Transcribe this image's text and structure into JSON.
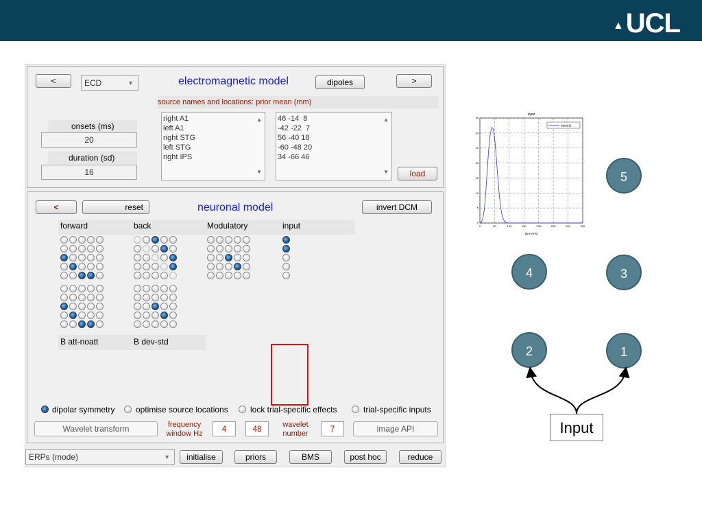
{
  "header": {
    "logo_text": "UCL"
  },
  "em_panel": {
    "prev_label": "<",
    "next_label": ">",
    "model_select": "ECD",
    "title": "electromagnetic model",
    "dipoles_label": "dipoles",
    "sources_caption": "source names and locations: prior mean (mm)",
    "onsets_label": "onsets (ms)",
    "onsets_value": "20",
    "duration_label": "duration (sd)",
    "duration_value": "16",
    "source_names": [
      "right A1",
      "left A1",
      "right STG",
      "left STG",
      "right IPS"
    ],
    "source_locations": [
      "46 -14  8",
      "-42 -22  7",
      "56 -40 18",
      "-60 -48 20",
      "34 -66 46"
    ],
    "load_label": "load"
  },
  "nm_panel": {
    "back_label": "<",
    "reset_label": "reset",
    "title": "neuronal model",
    "invert_label": "invert DCM",
    "col_headers": [
      "forward",
      "back",
      "Modulatory",
      "input"
    ],
    "b_labels": [
      "B att-noatt",
      "B dev-std"
    ],
    "options": [
      "dipolar symmetry",
      "optimise source locations",
      "lock trial-specific effects",
      "trial-specific inputs"
    ],
    "options_checked": [
      true,
      false,
      false,
      false
    ],
    "wavelet_label": "Wavelet transform",
    "freq_label": "frequency window Hz",
    "freq_low": "4",
    "freq_high": "48",
    "wavelet_num_label": "wavelet number",
    "wavelet_num": "7",
    "image_api_label": "image API"
  },
  "bottom_bar": {
    "mode_select": "ERPs (mode)",
    "buttons": [
      "initialise",
      "priors",
      "BMS",
      "post hoc",
      "reduce"
    ]
  },
  "plot": {
    "title": "input",
    "legend": "input(1)",
    "xlabel": "time (ms)",
    "x_ticks": [
      "0",
      "50",
      "100",
      "150",
      "200",
      "250",
      "300",
      "350"
    ],
    "y_ticks": [
      "0",
      "5",
      "10",
      "15",
      "20",
      "25",
      "30",
      "35"
    ],
    "x": [
      0,
      5,
      10,
      15,
      20,
      25,
      30,
      35,
      40,
      45,
      50,
      55,
      60,
      65,
      70,
      75,
      80,
      85,
      90,
      100,
      150,
      200,
      250,
      300,
      350
    ],
    "y": [
      0,
      0.3,
      1.5,
      4.5,
      10,
      17.5,
      24.5,
      29.5,
      31.8,
      31.5,
      28.5,
      23,
      16.5,
      10.5,
      5.8,
      2.8,
      1.2,
      0.4,
      0.1,
      0,
      0,
      0,
      0,
      0,
      0
    ],
    "xlim": [
      0,
      350
    ],
    "ylim": [
      0,
      35
    ],
    "line_color": "#3333cc"
  },
  "diagram": {
    "nodes": [
      "5",
      "4",
      "3",
      "2",
      "1"
    ],
    "input_label": "Input",
    "node_color": "#54808f"
  }
}
